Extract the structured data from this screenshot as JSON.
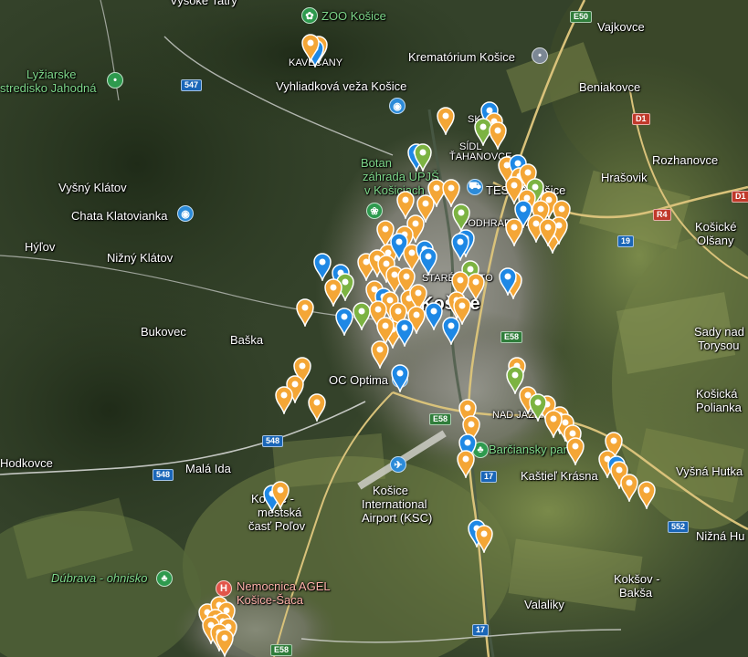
{
  "labels": {
    "vysoke_tatry": "Vysoké Tatry",
    "zoo": "ZOO Košice",
    "kavecany": "KAVEČANY",
    "krematorium": "Krematórium Košice",
    "vajkovce": "Vajkovce",
    "lyziarske_1": "Lyžiarske",
    "lyziarske_2": "stredisko Jahodná",
    "vyhliadkova": "Vyhliadková veža Košice",
    "beniakovce": "Beniakovce",
    "sidlisko_ku": "SK",
    "sidlisko_tahanovce_1": "SÍDL",
    "sidlisko_tahanovce_2": "ŤAHANOVCE",
    "rozhanovce": "Rozhanovce",
    "botanicka_1": "Botan",
    "botanicka_2": "záhrada UPJŠ",
    "botanicka_3": "v Košiciach",
    "hrasovik": "Hrašovik",
    "tesco": "TESCO Košice",
    "vysny_klatov": "Vyšný Klátov",
    "chata": "Chata Klatovianka",
    "kosicke_olsany_1": "Košické",
    "kosicke_olsany_2": "Olšany",
    "hylov": "Hýľov",
    "nizny_klatov": "Nižný Klátov",
    "podhradova": "PODHRADOVÁ",
    "stare_mesto": "STARÉ MESTO",
    "kosice": "Košice",
    "bukovec": "Bukovec",
    "baska": "Baška",
    "sady_1": "Sady nad",
    "sady_2": "Torysou",
    "oc_optima": "OC Optima",
    "kosicka_polianka_1": "Košická",
    "kosicka_polianka_2": "Polianka",
    "nad_jazerom": "NAD JAZEROM",
    "hodkovce": "Hodkovce",
    "mala_ida": "Malá Ida",
    "barciansky": "Barčiansky park",
    "kastiel": "Kaštieľ Krásna",
    "vysna_hutka": "Vyšná Hutka",
    "polov_1": "Košice -",
    "polov_2": "mestská",
    "polov_3": "časť Poľov",
    "airport_1": "Košice",
    "airport_2": "International",
    "airport_3": "Airport (KSC)",
    "nizna_hutka": "Nižná Hu",
    "dubrava": "Dúbrava - ohnisko",
    "kokšov_1": "Kokšov -",
    "kokšov_2": "Bakša",
    "nemocnica_1": "Nemocnica AGEL",
    "nemocnica_2": "Košice-Šaca",
    "valaliky": "Valaliky"
  },
  "shields": {
    "e50": "E50",
    "r547": "547",
    "d1a": "D1",
    "d1b": "D1",
    "r4": "R4",
    "r19": "19",
    "e58a": "E58",
    "e58b": "E58",
    "r548a": "548",
    "r548b": "548",
    "r17a": "17",
    "r17b": "17",
    "r552": "552",
    "e58c": "E58"
  },
  "poi_icons": {
    "zoo": "paw-icon",
    "krematorium": "pin-icon",
    "lyziarske": "pin-icon",
    "vyhliadkova": "camera-icon",
    "botanicka": "flower-icon",
    "tesco": "shopping-cart-icon",
    "chata": "camera-icon",
    "oc_optima": "shopping-bag-icon",
    "barciansky": "tree-icon",
    "airport": "airplane-icon",
    "dubrava": "tree-icon",
    "nemocnica": "hospital-icon"
  },
  "poi_glyphs": {
    "paw": "✿",
    "pin": "•",
    "camera": "◉",
    "flower": "❀",
    "cart": "⛟",
    "bag": "▣",
    "tree": "♣",
    "plane": "✈",
    "hospital": "H"
  },
  "colors": {
    "pin_orange": "#f4a636",
    "pin_blue": "#1e88e5",
    "pin_green": "#7cb342",
    "road_yellow": "#d9c27a",
    "road_white": "#e8e8e8"
  },
  "marker_summary": {
    "orange": 150,
    "blue": 18,
    "green": 11
  }
}
